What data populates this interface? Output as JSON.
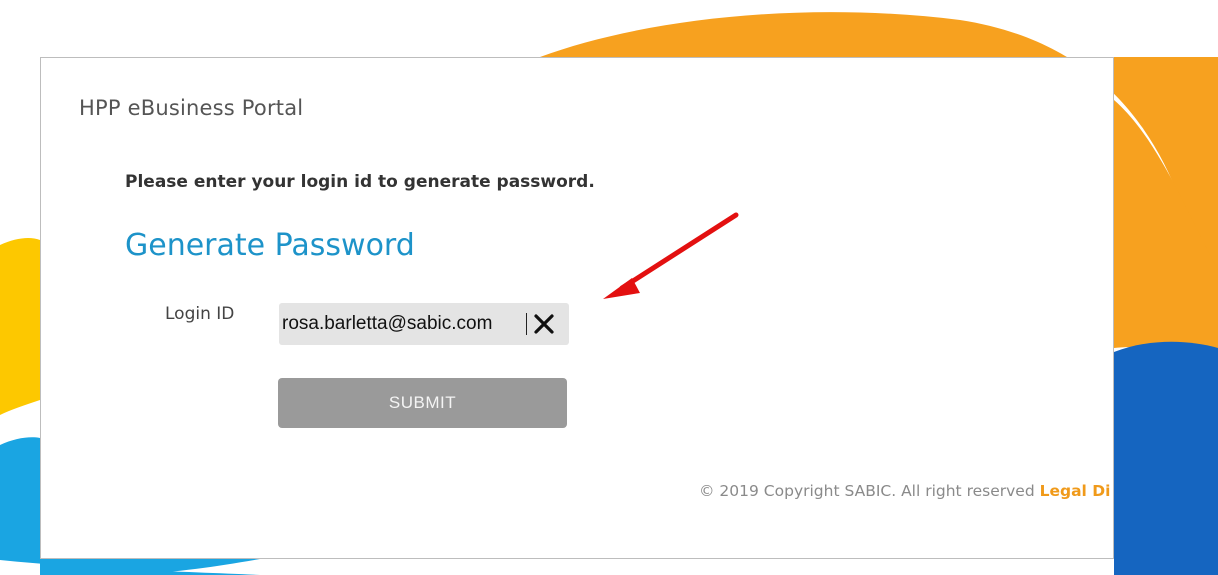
{
  "portal": {
    "title": "HPP eBusiness Portal"
  },
  "form": {
    "instruction": "Please enter your login id to generate password.",
    "heading": "Generate Password",
    "login_label": "Login ID",
    "login_value": "rosa.barletta@sabic.com",
    "submit_label": "SUBMIT"
  },
  "footer": {
    "copyright": "© 2019 Copyright SABIC. All right reserved",
    "legal_link": "Legal Di"
  },
  "icons": {
    "clear": "close-icon",
    "annotation": "red-arrow-icon"
  },
  "colors": {
    "heading": "#1d93c9",
    "submit_bg": "#9a9a9a",
    "legal_link": "#f09a1a",
    "orange_wave": "#f7a11f",
    "blue_wave": "#1565c0",
    "yellow_wave": "#fdc800",
    "light_blue_wave": "#1aa5e2",
    "arrow": "#e31010"
  }
}
